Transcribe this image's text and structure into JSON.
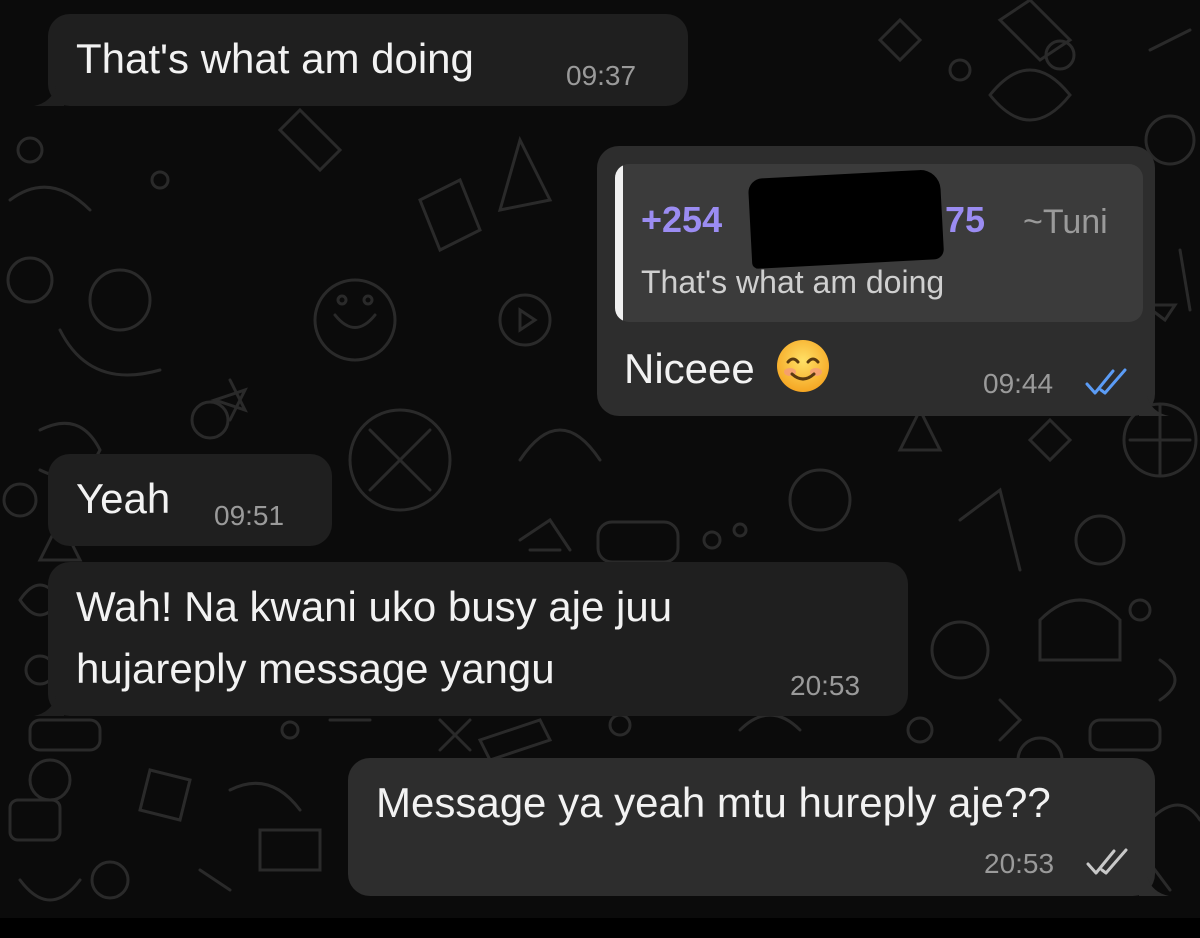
{
  "messages": [
    {
      "direction": "incoming",
      "text": "That's what am doing",
      "time": "09:37"
    },
    {
      "direction": "outgoing",
      "reply_to": {
        "sender_prefix": "+254",
        "sender_suffix": "75",
        "sender_alias": "~Tuni",
        "text": "That's what am doing"
      },
      "text": "Niceee",
      "emoji": "smiling-face-emoji",
      "time": "09:44",
      "status": "read"
    },
    {
      "direction": "incoming",
      "text": "Yeah",
      "time": "09:51"
    },
    {
      "direction": "incoming",
      "text_lines": [
        "Wah! Na kwani uko busy aje juu",
        "hujareply message yangu"
      ],
      "time": "20:53"
    },
    {
      "direction": "outgoing",
      "text": "Message ya yeah mtu hureply aje??",
      "time": "20:53",
      "status": "delivered"
    }
  ],
  "colors": {
    "background": "#0b0b0b",
    "incoming_bubble": "#1f1f1f",
    "outgoing_bubble": "#2d2d2d",
    "quote_sender": "#9b8cf2",
    "read_ticks": "#5b9cf6",
    "delivered_ticks": "#c8c8c8"
  }
}
